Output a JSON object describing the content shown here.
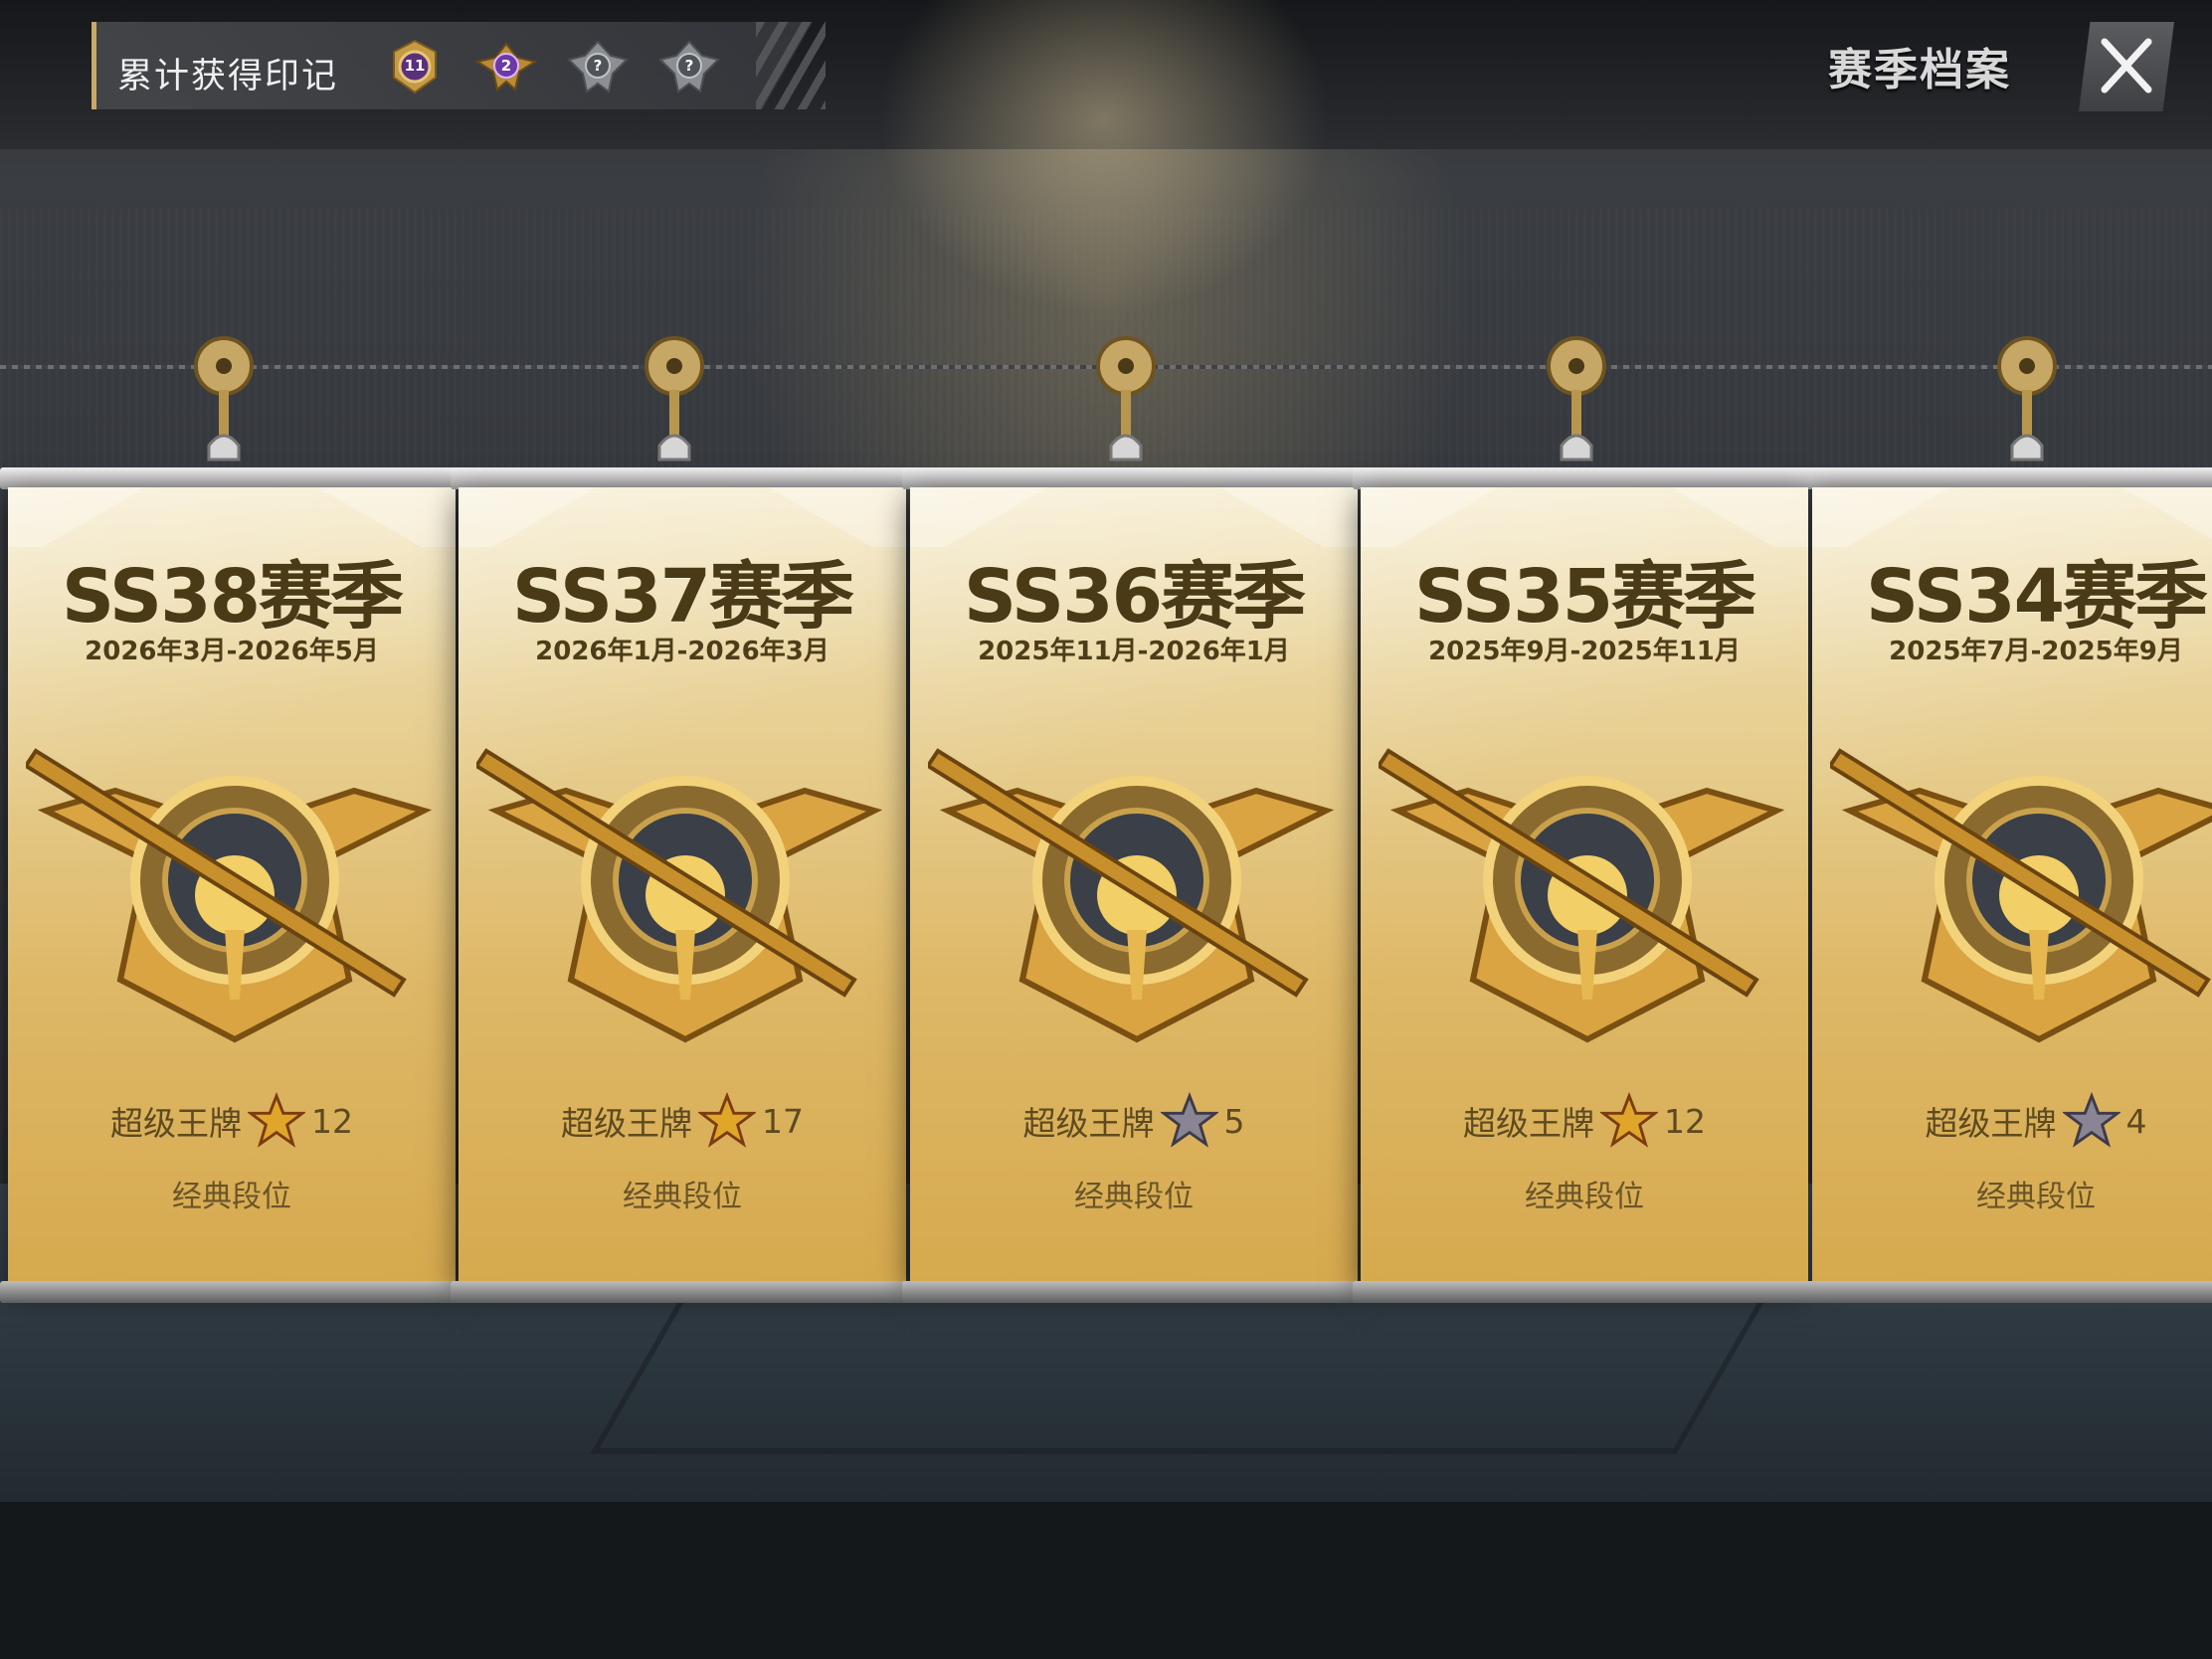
{
  "header": {
    "label": "累计获得印记",
    "marks": [
      {
        "icon": "purple-level-badge-icon",
        "number": "11"
      },
      {
        "icon": "purple-winged-badge-icon",
        "number": "2"
      },
      {
        "icon": "locked-silver-badge-icon",
        "number": "?"
      },
      {
        "icon": "locked-silver-badge-icon",
        "number": "?"
      }
    ]
  },
  "archive_button": "赛季档案",
  "close_icon": "close-icon",
  "banners": [
    {
      "title": "SS38赛季",
      "date": "2026年3月-2026年5月",
      "rank": "超级王牌",
      "stars": "12",
      "star_color": "gold",
      "mode": "经典段位"
    },
    {
      "title": "SS37赛季",
      "date": "2026年1月-2026年3月",
      "rank": "超级王牌",
      "stars": "17",
      "star_color": "gold",
      "mode": "经典段位"
    },
    {
      "title": "SS36赛季",
      "date": "2025年11月-2026年1月",
      "rank": "超级王牌",
      "stars": "5",
      "star_color": "silver",
      "mode": "经典段位"
    },
    {
      "title": "SS35赛季",
      "date": "2025年9月-2025年11月",
      "rank": "超级王牌",
      "stars": "12",
      "star_color": "gold",
      "mode": "经典段位"
    },
    {
      "title": "SS34赛季",
      "date": "2025年7月-2025年9月",
      "rank": "超级王牌",
      "stars": "4",
      "star_color": "silver",
      "mode": "经典段位"
    }
  ],
  "colors": {
    "gold_star": "#e0a62a",
    "silver_star": "#8a8594",
    "title_text": "#4a3a15"
  }
}
